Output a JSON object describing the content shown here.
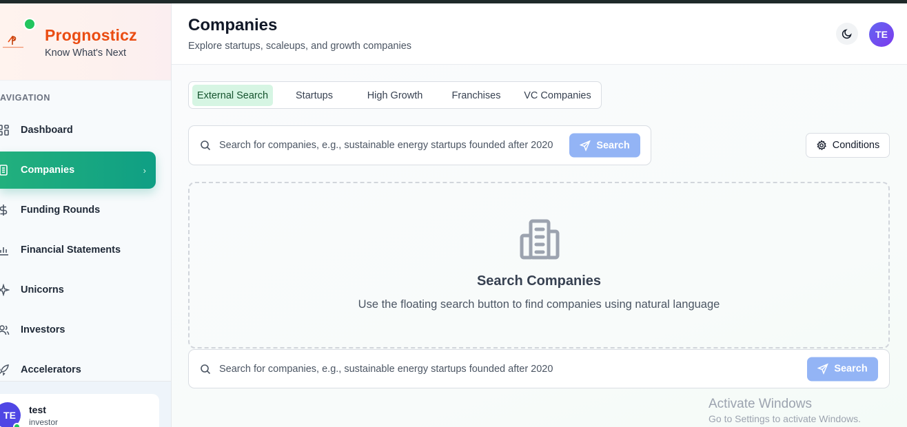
{
  "brand": {
    "name": "Prognosticz",
    "tagline": "Know What's Next",
    "logo_text": "PROGNOSTICZ"
  },
  "sidebar": {
    "heading": "AVIGATION",
    "items": [
      {
        "label": "Dashboard",
        "icon": "grid-icon"
      },
      {
        "label": "Companies",
        "icon": "building-icon",
        "active": true
      },
      {
        "label": "Funding Rounds",
        "icon": "dollar-icon"
      },
      {
        "label": "Financial Statements",
        "icon": "bar-chart-icon"
      },
      {
        "label": "Unicorns",
        "icon": "sparkle-icon"
      },
      {
        "label": "Investors",
        "icon": "users-icon"
      },
      {
        "label": "Accelerators",
        "icon": "rocket-icon"
      }
    ],
    "active_chevron": "›",
    "user": {
      "initials": "TE",
      "name": "test",
      "role": "investor"
    }
  },
  "header": {
    "title": "Companies",
    "subtitle": "Explore startups, scaleups, and growth companies",
    "avatar_initials": "TE"
  },
  "tabs": [
    {
      "label": "External Search",
      "active": true
    },
    {
      "label": "Startups"
    },
    {
      "label": "High Growth"
    },
    {
      "label": "Franchises"
    },
    {
      "label": "VC Companies"
    }
  ],
  "search_top": {
    "placeholder": "Search for companies, e.g., sustainable energy startups founded after 2020",
    "button": "Search"
  },
  "conditions": {
    "label": "Conditions"
  },
  "empty_state": {
    "title": "Search Companies",
    "description": "Use the floating search button to find companies using natural language"
  },
  "search_bottom": {
    "placeholder": "Search for companies, e.g., sustainable energy startups founded after 2020",
    "button": "Search"
  },
  "watermark": {
    "title": "Activate Windows",
    "subtitle": "Go to Settings to activate Windows."
  },
  "colors": {
    "brand": "#ea4c12",
    "accent": "#10a37f",
    "search_button": "#93b4f5",
    "avatar": "#6366f1"
  }
}
